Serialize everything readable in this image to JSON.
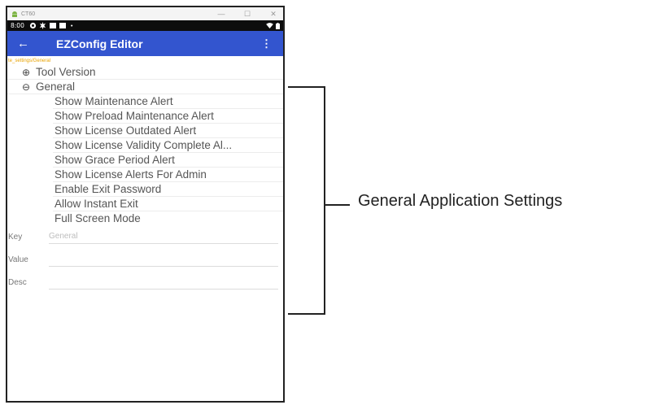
{
  "window": {
    "title": "CT60",
    "controls": {
      "minimize": "—",
      "maximize": "☐",
      "close": "✕"
    }
  },
  "statusbar": {
    "time": "8:00",
    "dot": "•"
  },
  "appbar": {
    "back": "←",
    "title": "EZConfig Editor",
    "menu": "⋮"
  },
  "path": "te_settings/General",
  "tree": {
    "collapsed_symbol": "⊕",
    "expanded_symbol": "⊖",
    "tool_version": "Tool Version",
    "general": "General",
    "children": [
      "Show Maintenance Alert",
      "Show Preload Maintenance Alert",
      "Show License Outdated Alert",
      "Show License Validity Complete Al...",
      "Show Grace Period Alert",
      "Show License Alerts For Admin",
      "Enable Exit Password",
      "Allow Instant Exit",
      "Full Screen Mode"
    ]
  },
  "fields": {
    "key_label": "Key",
    "key_placeholder": "General",
    "value_label": "Value",
    "value_placeholder": "",
    "desc_label": "Desc",
    "desc_placeholder": ""
  },
  "annotation": {
    "label": "General Application Settings"
  },
  "colors": {
    "appbar": "#3355cf",
    "path": "#e8a200",
    "statusbar": "#0d0d0d"
  }
}
